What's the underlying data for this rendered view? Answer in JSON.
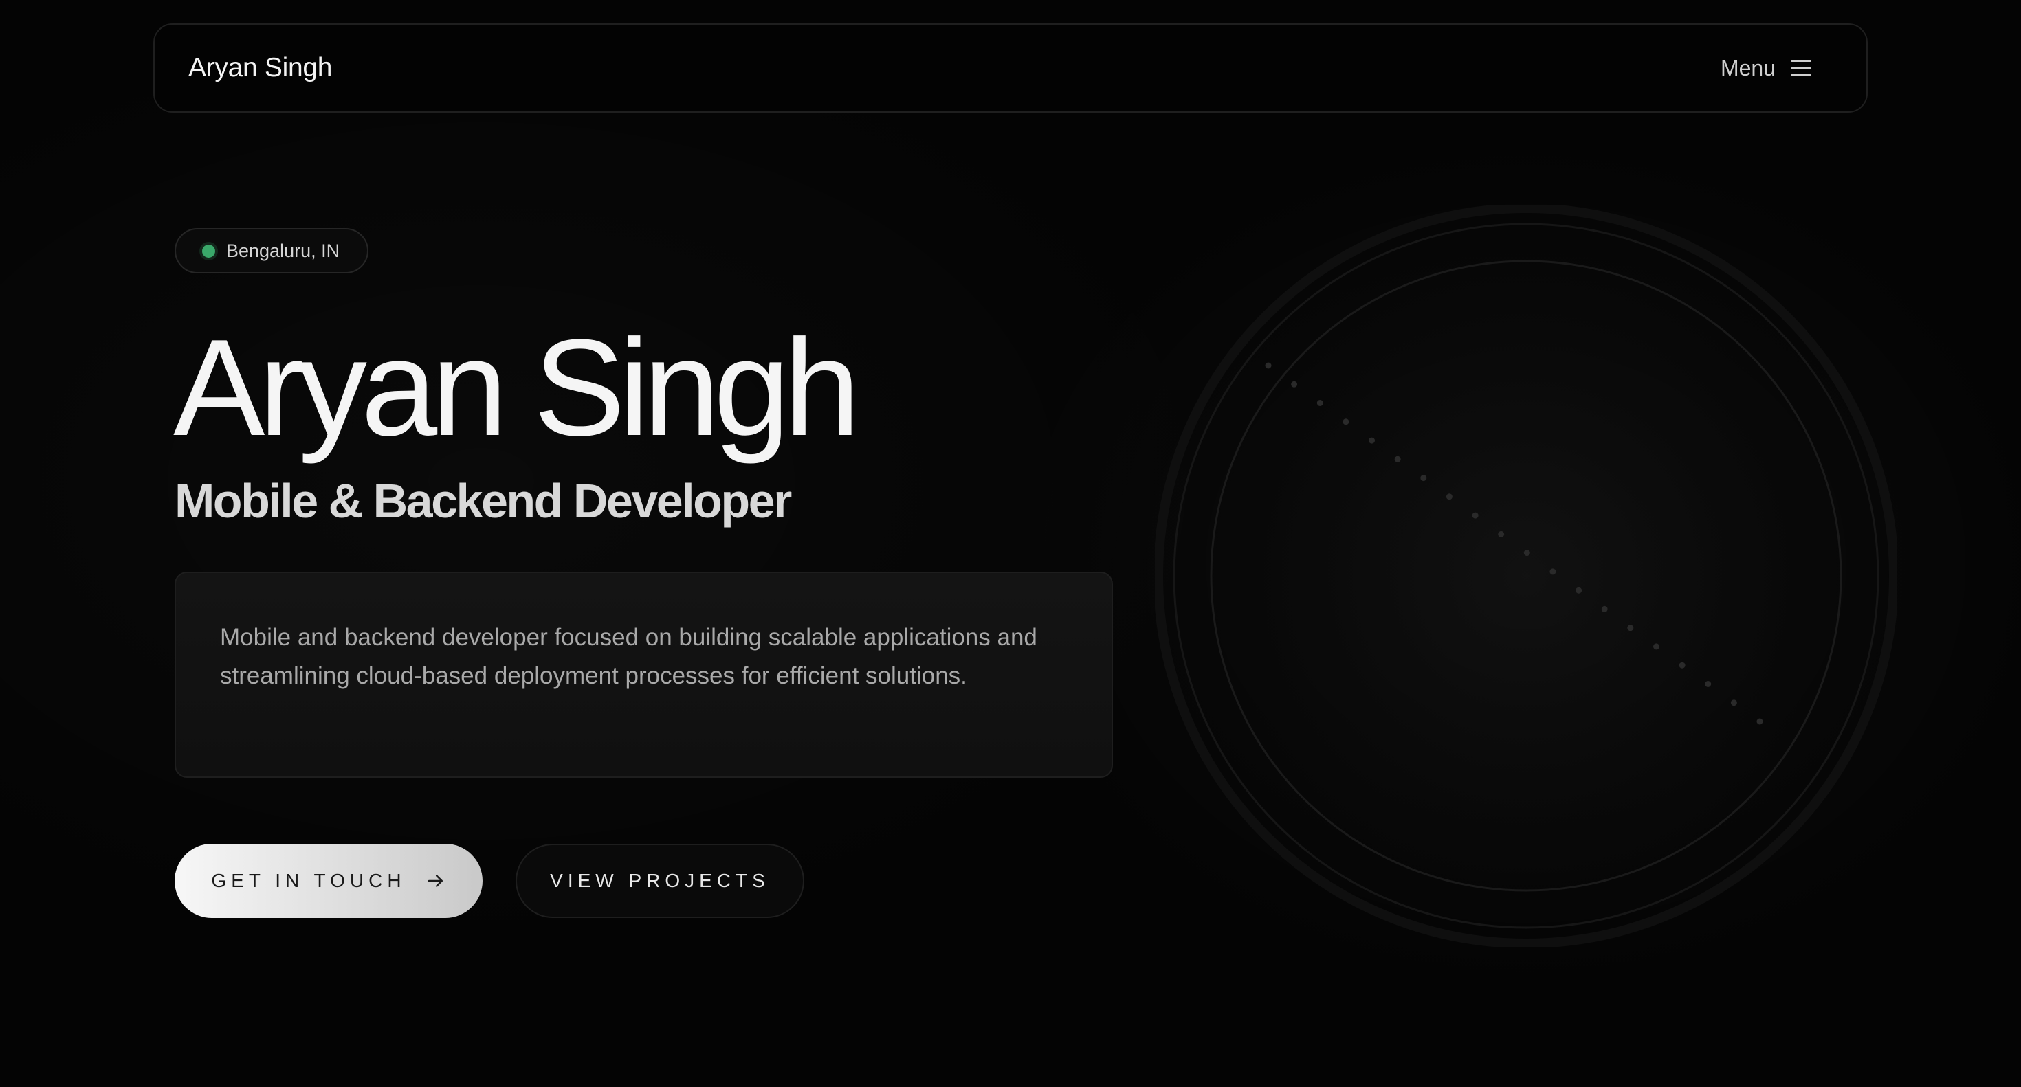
{
  "navbar": {
    "brand": "Aryan Singh",
    "menu_label": "Menu",
    "menu_icon": "hamburger-icon"
  },
  "location": {
    "text": "Bengaluru, IN",
    "status_color": "#3aa86a"
  },
  "hero": {
    "name": "Aryan Singh",
    "role": "Mobile & Backend Developer",
    "bio": "Mobile and backend developer focused on building scalable applications and streamlining cloud-based deployment processes for efficient solutions."
  },
  "actions": {
    "primary_label": "GET IN TOUCH",
    "primary_icon": "arrow-right-icon",
    "secondary_label": "VIEW PROJECTS"
  },
  "theme": {
    "background": "#040404",
    "text": "#f5f5f5",
    "muted": "#a9a9a9",
    "accent": "#3aa86a"
  }
}
